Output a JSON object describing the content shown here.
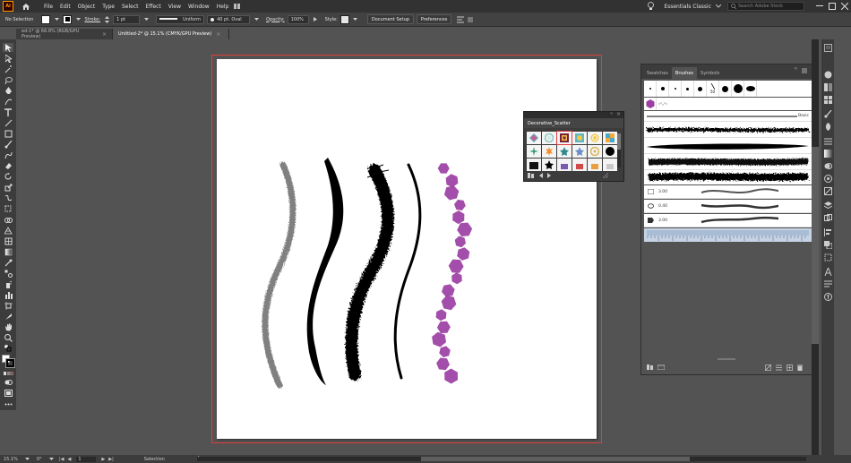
{
  "app": {
    "logo": "Ai"
  },
  "menu": [
    "File",
    "Edit",
    "Object",
    "Type",
    "Select",
    "Effect",
    "View",
    "Window",
    "Help"
  ],
  "header_right": {
    "workspace": "Essentials Classic",
    "search_placeholder": "Search Adobe Stock"
  },
  "control_bar": {
    "selection": "No Selection",
    "stroke_label": "Stroke:",
    "stroke_weight": "1 pt",
    "profile": "Uniform",
    "brush": "40 pt. Oval",
    "opacity_label": "Opacity:",
    "opacity": "100%",
    "style_label": "Style:",
    "document_setup": "Document Setup",
    "preferences": "Preferences"
  },
  "tabs": [
    {
      "label": "ed-1* @ 66.8% (RGB/GPU Preview)",
      "active": false
    },
    {
      "label": "Untitled-2* @ 15.1% (CMYK/GPU Preview)",
      "active": true
    }
  ],
  "brushes_panel": {
    "tabs": [
      "Swatches",
      "Brushes",
      "Symbols"
    ],
    "active_tab": "Brushes",
    "calligraphic_top": [
      "50"
    ],
    "basic_label": "Basic",
    "art_rows": [
      {
        "size": "3.00"
      },
      {
        "size": "0.40"
      },
      {
        "size": "3.00"
      }
    ]
  },
  "scatter_panel": {
    "title": "Decorative_Scatter"
  },
  "status_bar": {
    "zoom": "15.1%",
    "rotation": "0°",
    "artboard": "1",
    "tool": "Selection"
  },
  "colors": {
    "accent_purple": "#9b3fa3",
    "artboard_border": "#e03c3c",
    "ui_dark": "#323232",
    "ui_mid": "#424242"
  }
}
